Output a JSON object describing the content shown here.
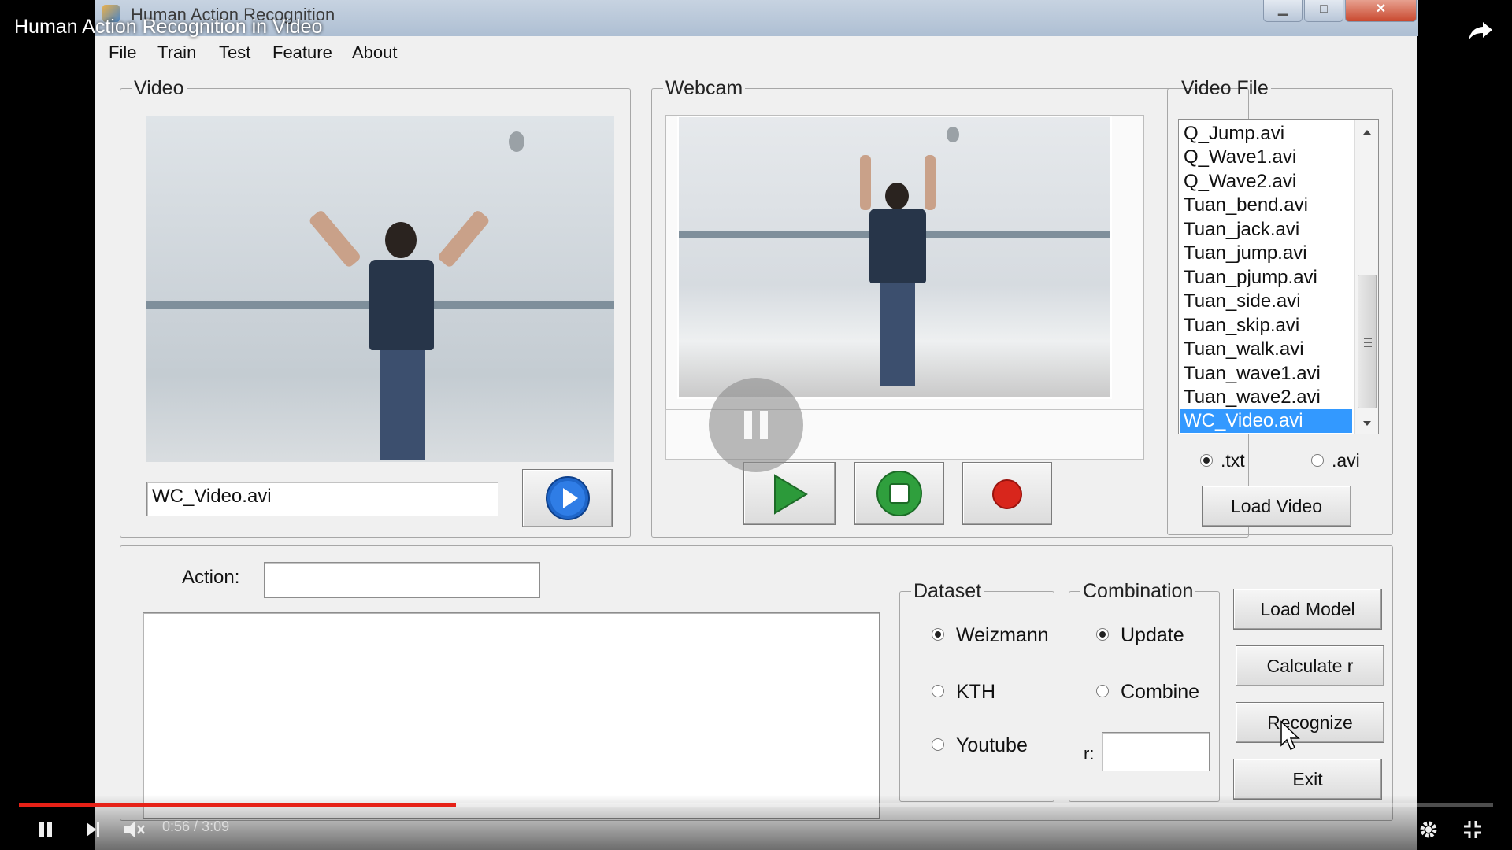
{
  "player": {
    "video_title": "Human Action Recognition in Video",
    "time_current": "0:56",
    "time_separator": " / ",
    "time_total": "3:09",
    "progress": 0.2963,
    "accent_color": "#e62117"
  },
  "window": {
    "title": "Human Action Recognition",
    "minimize_glyph": "▁",
    "maximize_glyph": "□",
    "close_glyph": "✕"
  },
  "menu": [
    "File",
    "Train",
    "Test",
    "Feature",
    "About"
  ],
  "video_panel": {
    "legend": "Video",
    "filename": "WC_Video.avi"
  },
  "webcam_panel": {
    "legend": "Webcam"
  },
  "file_panel": {
    "legend": "Video File",
    "files": [
      "Q_Jump.avi",
      "Q_Wave1.avi",
      "Q_Wave2.avi",
      "Tuan_bend.avi",
      "Tuan_jack.avi",
      "Tuan_jump.avi",
      "Tuan_pjump.avi",
      "Tuan_side.avi",
      "Tuan_skip.avi",
      "Tuan_walk.avi",
      "Tuan_wave1.avi",
      "Tuan_wave2.avi",
      "WC_Video.avi"
    ],
    "selected_index": 12,
    "radio_txt": ".txt",
    "radio_avi": ".avi",
    "load_video": "Load Video"
  },
  "action": {
    "label": "Action:",
    "value": ""
  },
  "dataset": {
    "legend": "Dataset",
    "options": [
      "Weizmann",
      "KTH",
      "Youtube"
    ],
    "selected": "Weizmann"
  },
  "combination": {
    "legend": "Combination",
    "options": [
      "Update",
      "Combine"
    ],
    "selected": "Update",
    "r_label": "r:",
    "r_value": ""
  },
  "buttons": {
    "load_model": "Load Model",
    "calculate_r": "Calculate r",
    "recognize": "Recognize",
    "exit": "Exit"
  }
}
